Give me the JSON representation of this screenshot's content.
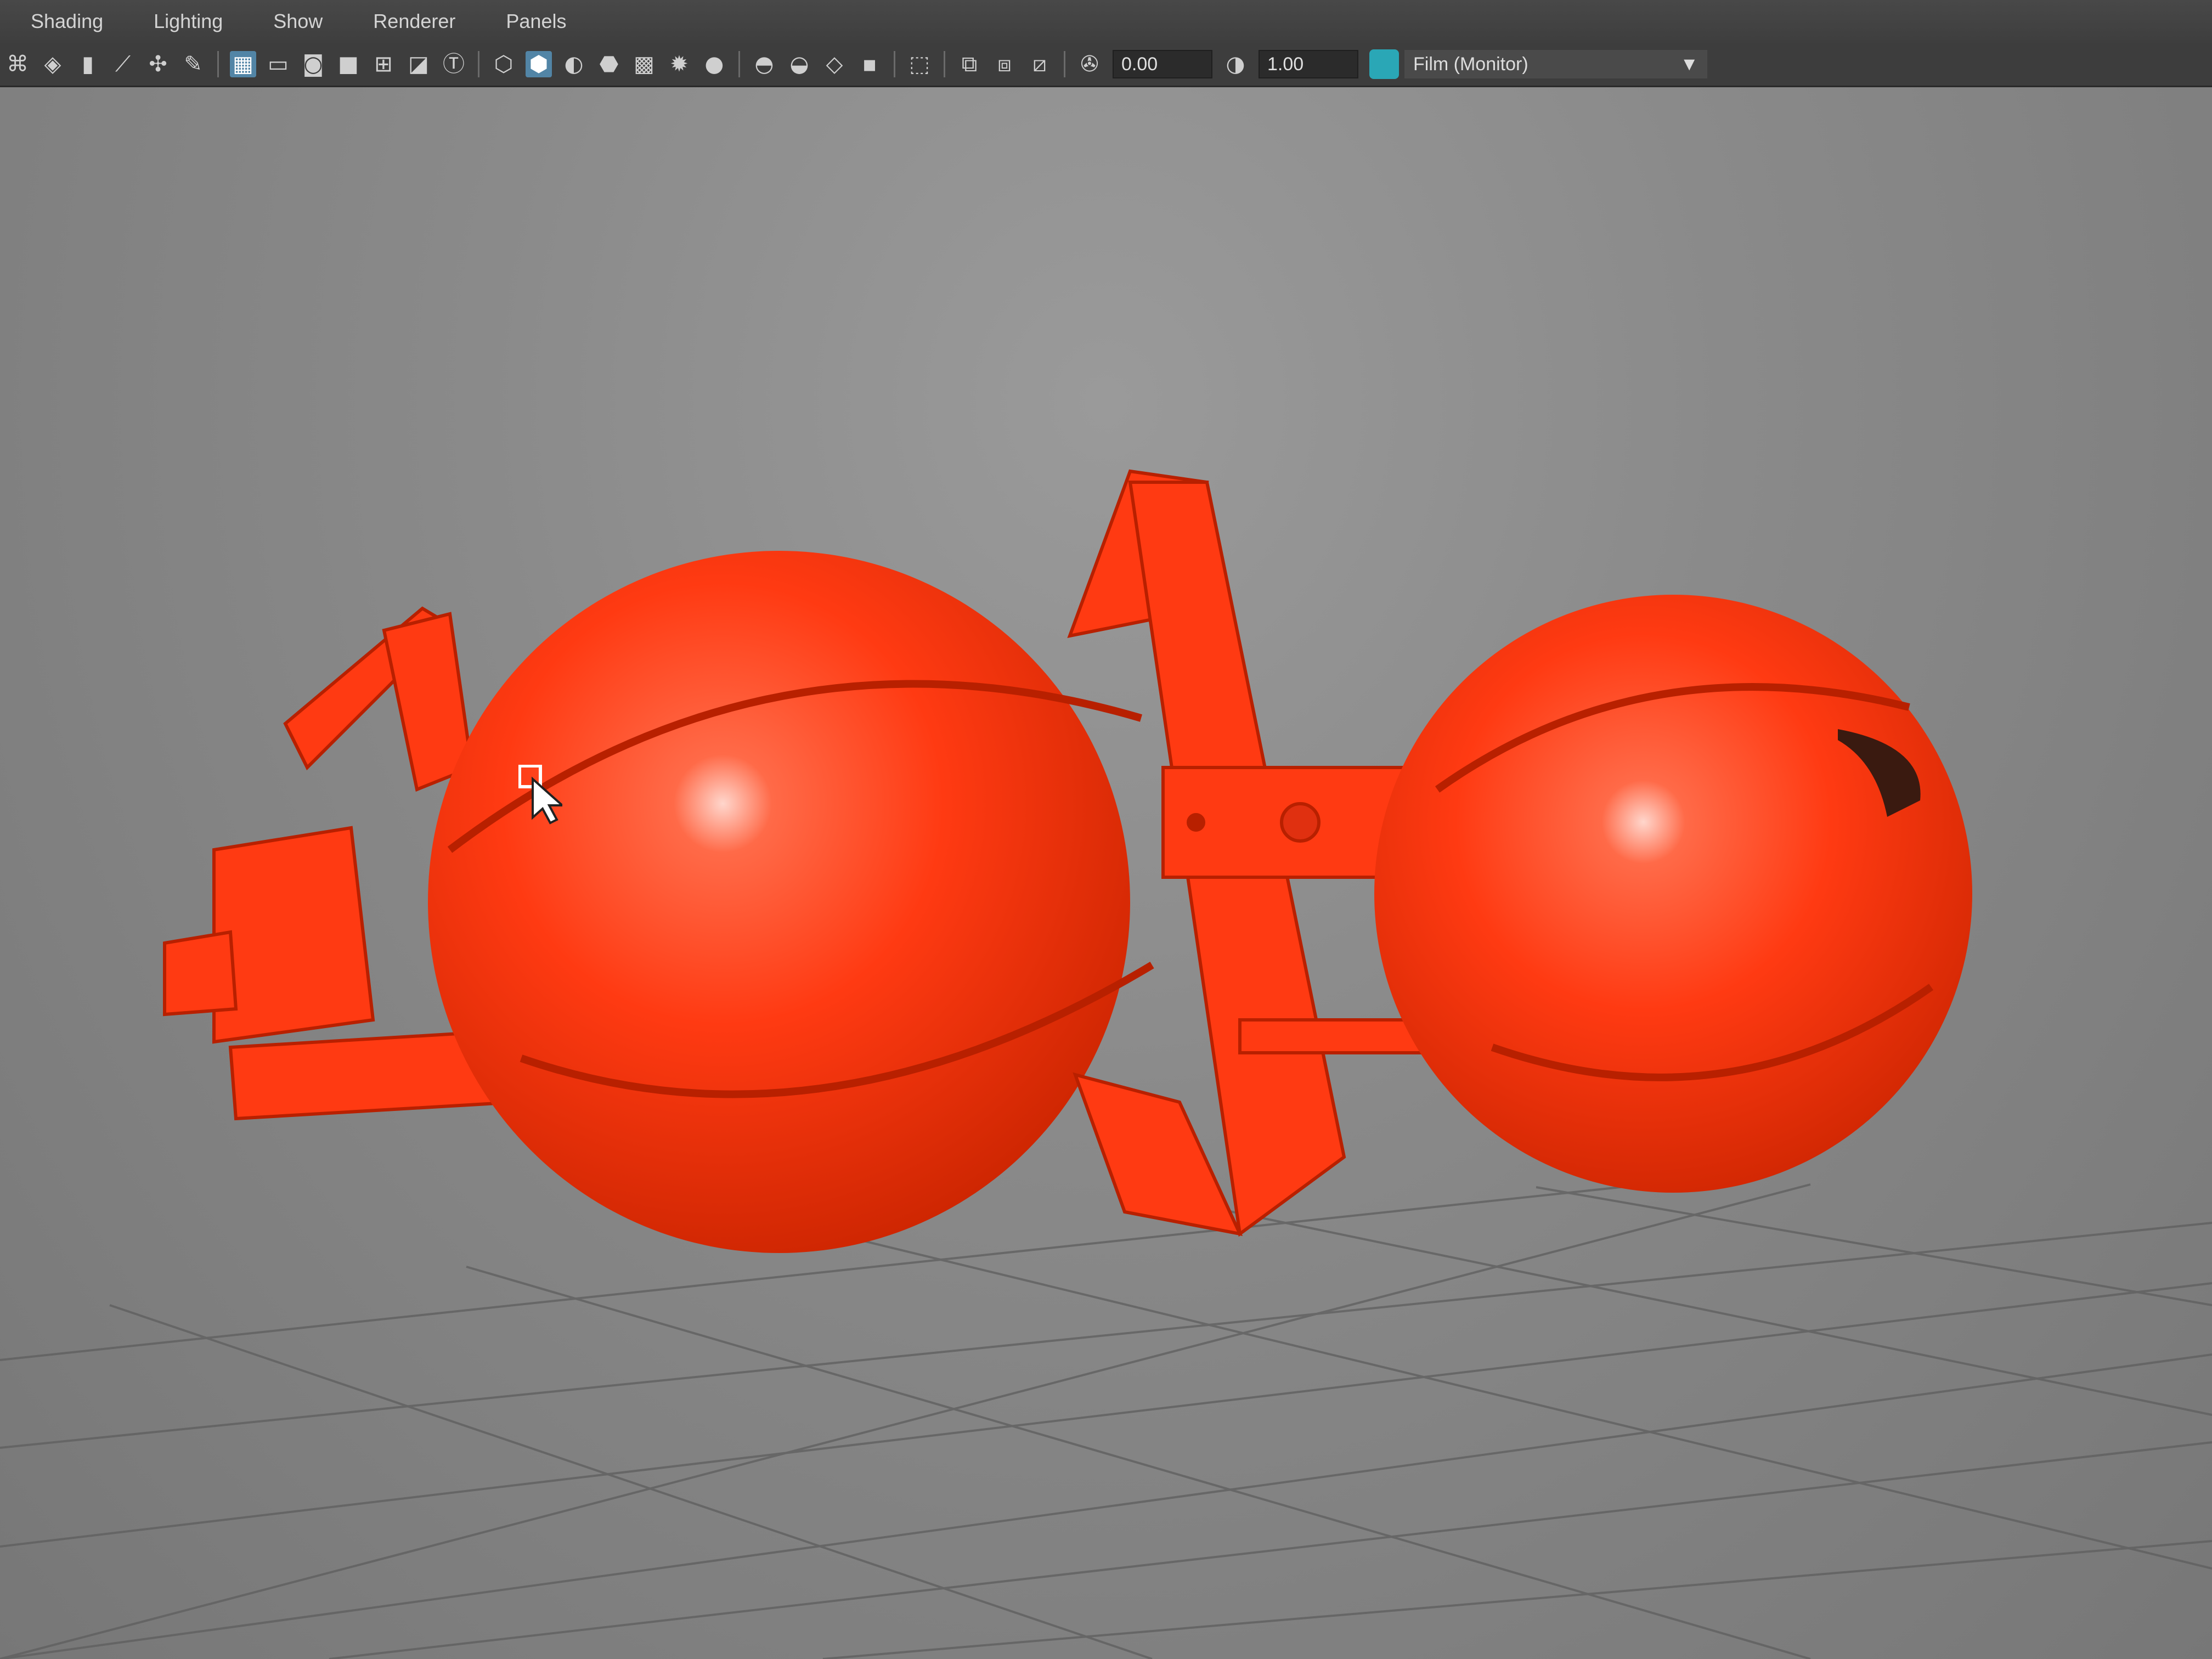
{
  "menu": [
    "Shading",
    "Lighting",
    "Show",
    "Renderer",
    "Panels"
  ],
  "toolbar": {
    "exposure_value": "0.00",
    "gamma_value": "1.00",
    "view_transform": "Film (Monitor)"
  },
  "scene": {
    "object_color": "#ff3a12",
    "grid_color": "#5e5e5e"
  }
}
